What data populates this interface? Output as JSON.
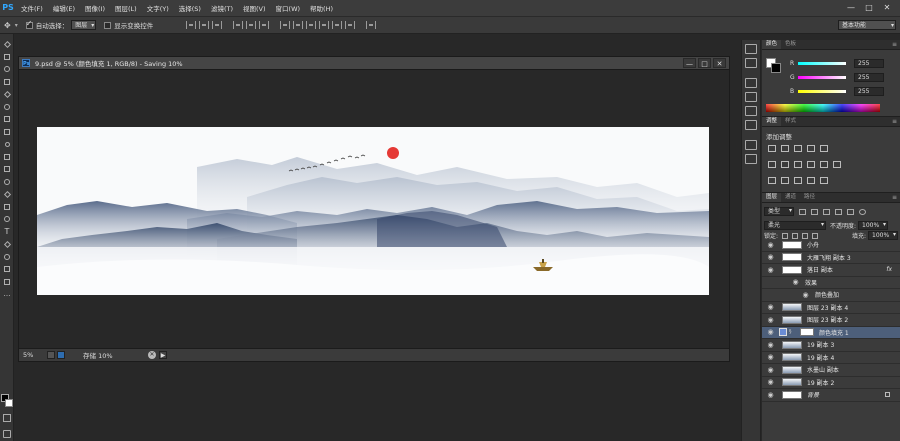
{
  "app": {
    "logo": "PS",
    "menu": [
      "文件(F)",
      "编辑(E)",
      "图像(I)",
      "图层(L)",
      "文字(Y)",
      "选择(S)",
      "滤镜(T)",
      "视图(V)",
      "窗口(W)",
      "帮助(H)"
    ],
    "window_controls": [
      "—",
      "□",
      "✕"
    ]
  },
  "options_bar": {
    "auto_select_label": "自动选择：",
    "auto_select_checked": true,
    "auto_select_value": "图层",
    "show_transform_label": "显示变换控件",
    "show_transform_checked": false,
    "workspace": "基本功能"
  },
  "document": {
    "title": "9.psd @ 5% (颜色填充 1, RGB/8) - Saving 10%",
    "zoom": "5%",
    "status": "存储 10%",
    "controls": [
      "—",
      "□",
      "✕"
    ]
  },
  "color_panel": {
    "tabs": [
      "颜色",
      "色板"
    ],
    "fg_color": "#ffffff",
    "bg_color": "#000000",
    "channels": [
      {
        "label": "R",
        "value": "255",
        "color": "#ff4040"
      },
      {
        "label": "G",
        "value": "255",
        "color": "#40ff40"
      },
      {
        "label": "B",
        "value": "255",
        "color": "#4060ff"
      }
    ]
  },
  "adjustments_panel": {
    "tabs": [
      "调整",
      "样式"
    ],
    "add_label": "添加调整"
  },
  "layers_panel": {
    "tabs": [
      "图层",
      "通道",
      "路径"
    ],
    "filter_kind": "类型",
    "blend_mode": "柔光",
    "opacity_label": "不透明度:",
    "opacity_value": "100%",
    "lock_label": "锁定:",
    "fill_label": "填充:",
    "fill_value": "100%",
    "layers": [
      {
        "name": "小舟",
        "type": "image"
      },
      {
        "name": "大雁飞翔 副本 3",
        "type": "image"
      },
      {
        "name": "落日 副本",
        "type": "image",
        "fx": "fx"
      },
      {
        "name": "效果",
        "type": "effect-group"
      },
      {
        "name": "颜色叠加",
        "type": "effect"
      },
      {
        "name": "图层 23 副本 4",
        "type": "image"
      },
      {
        "name": "图层 23 副本 2",
        "type": "image"
      },
      {
        "name": "颜色填充 1",
        "type": "fill",
        "selected": true
      },
      {
        "name": "19 副本 3",
        "type": "image"
      },
      {
        "name": "19 副本 4",
        "type": "image"
      },
      {
        "name": "水墨山 副本",
        "type": "image"
      },
      {
        "name": "19 副本 2",
        "type": "image"
      },
      {
        "name": "背景",
        "type": "background",
        "locked": true
      }
    ]
  },
  "artwork": {
    "sun_color": "#e53935",
    "mountain_color": "#6e7f9e"
  }
}
